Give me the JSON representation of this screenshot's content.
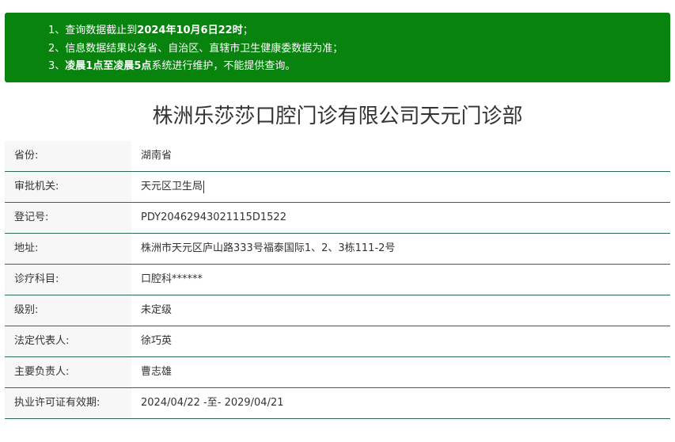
{
  "notice": {
    "line1_prefix": "1、查询数据截止到",
    "line1_bold": "2024年10月6日22时",
    "line1_suffix": "；",
    "line2": "2、信息数据结果以各省、自治区、直辖市卫生健康委数据为准；",
    "line3_prefix": "3、",
    "line3_bold": "凌晨1点至凌晨5点",
    "line3_suffix": "系统进行维护，不能提供查询。",
    "background_color": "#07830e"
  },
  "title": "株洲乐莎莎口腔门诊有限公司天元门诊部",
  "rows": [
    {
      "label": "省份:",
      "value": "湖南省"
    },
    {
      "label": "审批机关:",
      "value": "天元区卫生局"
    },
    {
      "label": "登记号:",
      "value": "PDY20462943021115D1522"
    },
    {
      "label": "地址:",
      "value": "株洲市天元区庐山路333号福泰国际1、2、3栋111-2号"
    },
    {
      "label": "诊疗科目:",
      "value": "口腔科******"
    },
    {
      "label": "级别:",
      "value": "未定级"
    },
    {
      "label": "法定代表人:",
      "value": "徐巧英"
    },
    {
      "label": "主要负责人:",
      "value": "曹志雄"
    },
    {
      "label": "执业许可证有效期:",
      "value": "2024/04/22 -至- 2029/04/21"
    }
  ],
  "colors": {
    "row_divider": "#2c6b4f",
    "label_background": "#f7f7f7"
  }
}
